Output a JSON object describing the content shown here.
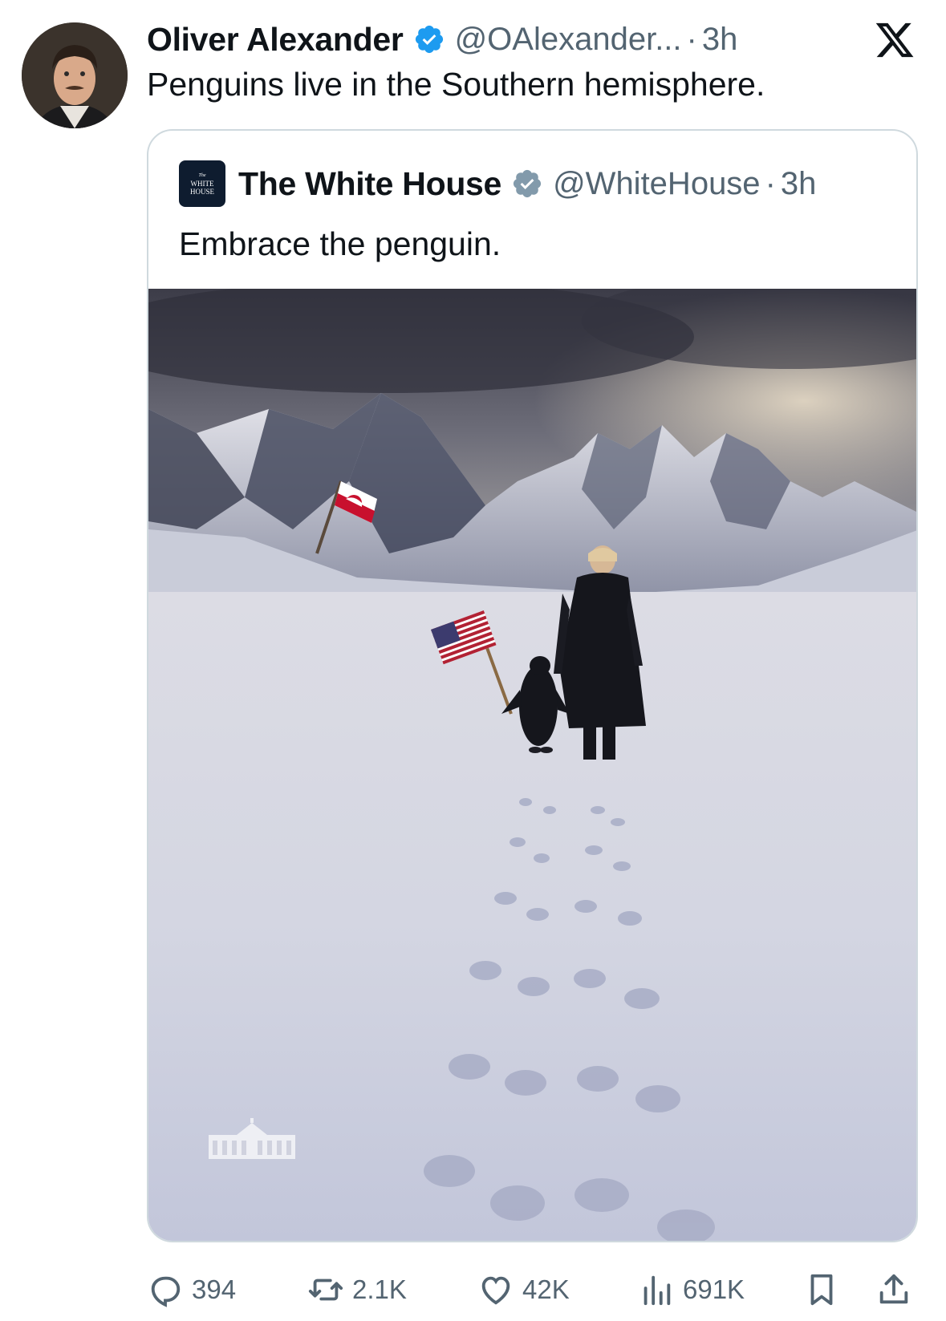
{
  "tweet": {
    "author_name": "Oliver Alexander",
    "handle": "@OAlexander...",
    "separator": "·",
    "time": "3h",
    "text": "Penguins live in the Southern hemisphere.",
    "verified": true
  },
  "quoted_tweet": {
    "author_name": "The White House",
    "avatar_lines": [
      "The",
      "WHITE",
      "HOUSE"
    ],
    "handle": "@WhiteHouse",
    "separator": "·",
    "time": "3h",
    "text": "Embrace the penguin.",
    "verified": true,
    "image_icon": "photo-snowy-mountains-penguin-flags"
  },
  "actions": {
    "replies": "394",
    "reposts": "2.1K",
    "likes": "42K",
    "views": "691K"
  },
  "icons": {
    "platform": "x-logo",
    "reply": "speech-bubble-icon",
    "repost": "repost-arrows-icon",
    "like": "heart-icon",
    "views": "bar-chart-icon",
    "bookmark": "bookmark-icon",
    "share": "share-upload-icon"
  },
  "colors": {
    "verified_badge": "#1d9bf0",
    "secondary_text": "#536471",
    "border": "#cfd9de"
  }
}
